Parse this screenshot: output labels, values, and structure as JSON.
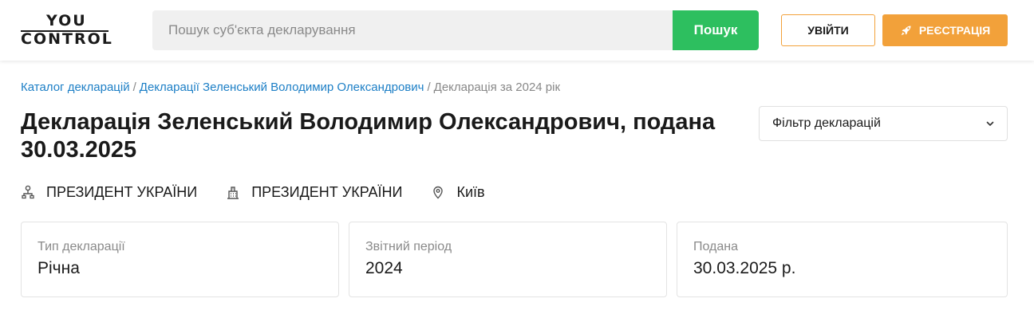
{
  "header": {
    "logo_top": "YOU",
    "logo_bottom": "CONTROL",
    "search_placeholder": "Пошук суб'єкта декларування",
    "search_button": "Пошук",
    "login_button": "УВІЙТИ",
    "register_button": "РЕЄСТРАЦІЯ"
  },
  "breadcrumb": {
    "items": [
      "Каталог декларацій",
      "Декларації Зеленський Володимир Олександрович",
      "Декларація за 2024 рік"
    ],
    "separator": "/"
  },
  "title": "Декларація Зеленський Володимир Олександрович, подана 30.03.2025",
  "filter": {
    "label": "Фільтр декларацій"
  },
  "meta": {
    "position": "ПРЕЗИДЕНТ УКРАЇНИ",
    "organization": "ПРЕЗИДЕНТ УКРАЇНИ",
    "city": "Київ"
  },
  "cards": [
    {
      "label": "Тип декларації",
      "value": "Річна"
    },
    {
      "label": "Звітний період",
      "value": "2024"
    },
    {
      "label": "Подана",
      "value": "30.03.2025 р."
    }
  ],
  "colors": {
    "search_button": "#2dbf5f",
    "register_button": "#f2a13a",
    "login_border": "#f2a13a",
    "link": "#1d7fc6"
  }
}
